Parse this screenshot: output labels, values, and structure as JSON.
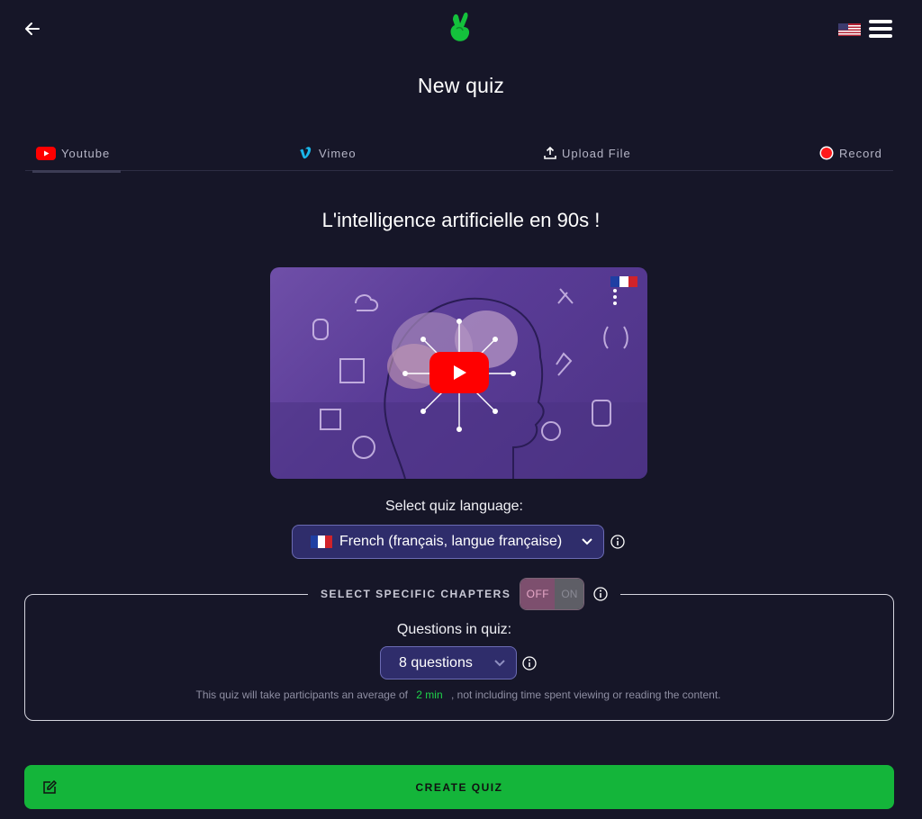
{
  "header": {
    "back_icon": "arrow-left-icon",
    "logo_icon": "green-hand-logo-icon",
    "language_flag": "us-flag-icon",
    "menu_icon": "hamburger-menu-icon"
  },
  "page": {
    "title": "New quiz"
  },
  "tabs": [
    {
      "label": "Youtube",
      "icon": "youtube-icon",
      "active": true
    },
    {
      "label": "Vimeo",
      "icon": "vimeo-icon",
      "active": false
    },
    {
      "label": "Upload File",
      "icon": "upload-icon",
      "active": false
    },
    {
      "label": "Record",
      "icon": "record-icon",
      "active": false
    }
  ],
  "video": {
    "title": "L'intelligence artificielle en 90s !",
    "thumbnail_icon": "video-thumbnail",
    "play_icon": "youtube-play-icon"
  },
  "language": {
    "label": "Select quiz language:",
    "selected": "French (français, langue française)",
    "flag": "fr-flag-icon"
  },
  "chapters": {
    "label": "SELECT SPECIFIC CHAPTERS",
    "toggle_off": "OFF",
    "toggle_on": "ON"
  },
  "questions": {
    "label": "Questions in quiz:",
    "selected": "8 questions"
  },
  "duration": {
    "prefix": "This quiz will take participants an average of",
    "value": "2 min",
    "suffix": ", not including time spent viewing or reading the content."
  },
  "create_button": {
    "label": "CREATE QUIZ",
    "icon": "edit-icon"
  },
  "colors": {
    "background": "#161628",
    "accent_green": "#14b53a",
    "select_bg": "#2f2d6b",
    "highlight_green": "#1fd34a"
  }
}
